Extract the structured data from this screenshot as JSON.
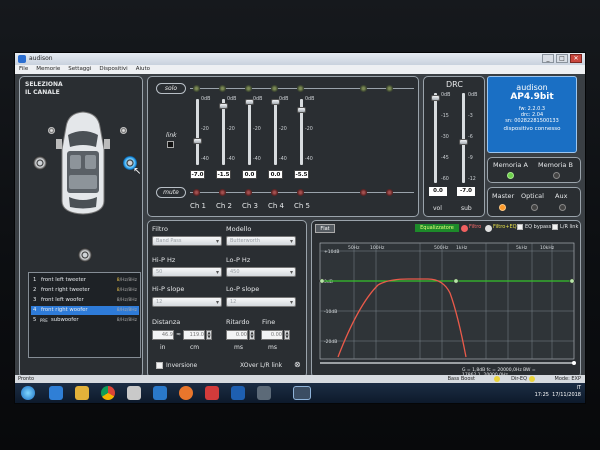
{
  "window": {
    "title": "audison"
  },
  "menu": [
    "File",
    "Memorie",
    "Settaggi",
    "Dispositivi",
    "Aiuto"
  ],
  "left_panel": {
    "title_line1": "SELEZIONA",
    "title_line2": "IL CANALE",
    "channels": [
      {
        "num": "1",
        "name": "front left tweeter",
        "freq_on": "8",
        "freq_rest": "/Hz/8Hz"
      },
      {
        "num": "2",
        "name": "front right tweeter",
        "freq_on": "8",
        "freq_rest": "/Hz/8Hz"
      },
      {
        "num": "3",
        "name": "front left woofer",
        "freq_on": "",
        "freq_rest": "8/Hz/8Hz"
      },
      {
        "num": "4",
        "name": "front right woofer",
        "freq_on": "",
        "freq_rest": "8/Hz/8Hz",
        "selected": true
      },
      {
        "num": "5",
        "prefix": "PRE",
        "name": "subwoofer",
        "freq_on": "",
        "freq_rest": "8/Hz/8Hz"
      }
    ]
  },
  "gain_panel": {
    "solo_label": "solo",
    "mute_label": "mute",
    "link_label": "link",
    "scale": [
      "0dB",
      "-20",
      "-40"
    ],
    "channels": [
      {
        "name": "Ch 1",
        "value": "-7.0",
        "level": 0.35
      },
      {
        "name": "Ch 2",
        "value": "-1.5",
        "level": 0.93
      },
      {
        "name": "Ch 3",
        "value": "0.0",
        "level": 1.0
      },
      {
        "name": "Ch 4",
        "value": "0.0",
        "level": 1.0
      },
      {
        "name": "Ch 5",
        "value": "-5.5",
        "level": 0.86
      }
    ]
  },
  "drc": {
    "title": "DRC",
    "vol_scale": [
      "0dB",
      "-15",
      "-30",
      "-45",
      "-60"
    ],
    "sub_scale": [
      "0dB",
      "-3",
      "-6",
      "-9",
      "-12"
    ],
    "vol_value": "0.0",
    "sub_value": "-7.0",
    "vol_label": "vol",
    "sub_label": "sub"
  },
  "device": {
    "brand": "audison",
    "model": "AP4.9bit",
    "fw": "fw: 2.2.0.3",
    "drc": "drc: 2.04",
    "sn": "sn: 00282281500133",
    "status": "dispositivo connesso"
  },
  "memory": {
    "a": "Memoria A",
    "b": "Memoria B"
  },
  "source": {
    "master": "Master",
    "optical": "Optical",
    "aux": "Aux"
  },
  "filter": {
    "filtro_label": "Filtro",
    "filtro_value": "Band Pass",
    "modello_label": "Modello",
    "modello_value": "Butterworth",
    "hip_label": "Hi-P Hz",
    "hip_value": "50",
    "lop_label": "Lo-P Hz",
    "lop_value": "450",
    "hips_label": "Hi-P slope",
    "hips_value": "12",
    "lops_label": "Lo-P slope",
    "lops_value": "12",
    "distanza_label": "Distanza",
    "dist_in": "46.9",
    "dist_cm": "119.0",
    "in_label": "in",
    "cm_label": "cm",
    "ritardo_label": "Ritardo",
    "ritardo_value": "0.00",
    "ritardo_unit": "ms",
    "fine_label": "Fine",
    "fine_value": "0.00",
    "fine_unit": "ms",
    "inversione_label": "Inversione",
    "xover_label": "XOver L/R link"
  },
  "eq": {
    "tab": "Flat",
    "equalizer_label": "Equalizzatore",
    "filtro_label": "Filtro",
    "filtro_eq_label": "Filtro+EQ",
    "bypass_label": "EQ bypass",
    "lr_link_label": "L/R link",
    "y_ticks": [
      "+10dB",
      "0dB",
      "-10dB",
      "-20dB"
    ],
    "x_ticks": [
      "50Hz",
      "100Hz",
      "500Hz",
      "1kHz",
      "5kHz",
      "10kHz"
    ],
    "info": "G = 1,8dB   fc = 20000,0Hz   BW = 17862,1..20000,0Hz"
  },
  "statusbar": {
    "left": "Pronto",
    "basso": "Bass Boost",
    "direq": "Dir-EQ",
    "mode": "Mode: EXP"
  },
  "taskbar": {
    "time": "17:25",
    "date": "17/11/2018",
    "lang": "IT"
  }
}
